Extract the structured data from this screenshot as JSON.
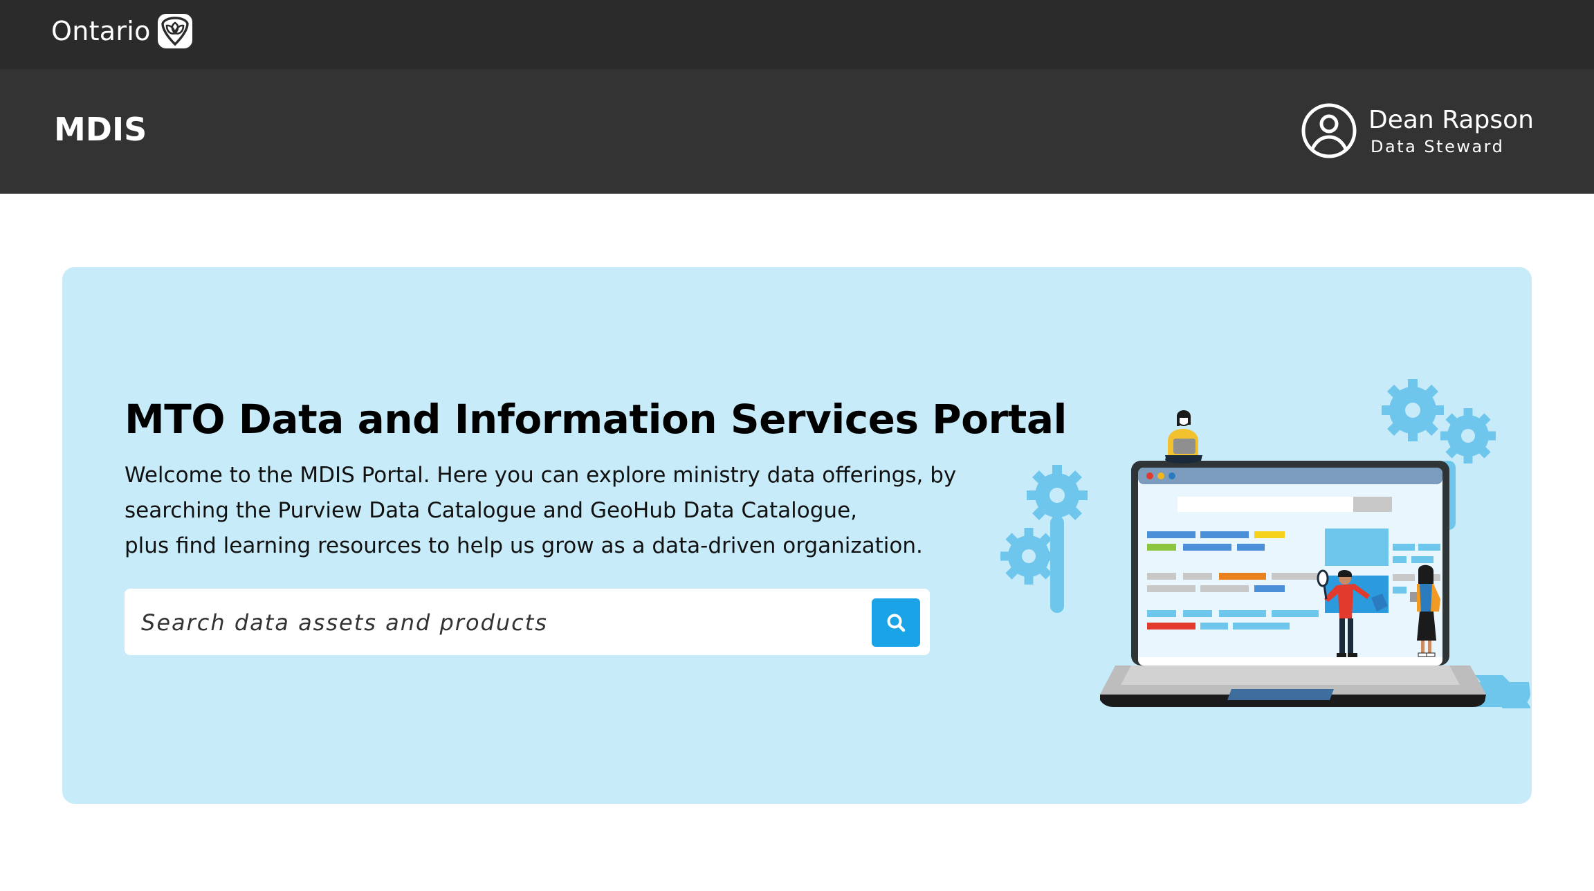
{
  "gov_header": {
    "logo_text": "Ontario",
    "logo_icon": "ontario-trillium-icon"
  },
  "app_header": {
    "app_name": "MDIS",
    "user": {
      "name": "Dean Rapson",
      "role": "Data Steward",
      "avatar_icon": "user-circle-icon"
    }
  },
  "hero": {
    "title": "MTO Data and Information Services Portal",
    "description_lines": [
      "Welcome to the MDIS Portal. Here you can explore ministry data offerings, by",
      "searching the Purview Data Catalogue and GeoHub Data Catalogue,",
      "plus find learning resources to help us grow as a data-driven organization."
    ],
    "search": {
      "placeholder": "Search data assets and products",
      "button_icon": "search-icon"
    },
    "illustration": "laptop-data-catalogue-illustration"
  },
  "colors": {
    "gov_bar": "#2b2b2b",
    "app_bar": "#333333",
    "hero_bg": "#c7ebf8",
    "search_button": "#1aa3e6"
  }
}
